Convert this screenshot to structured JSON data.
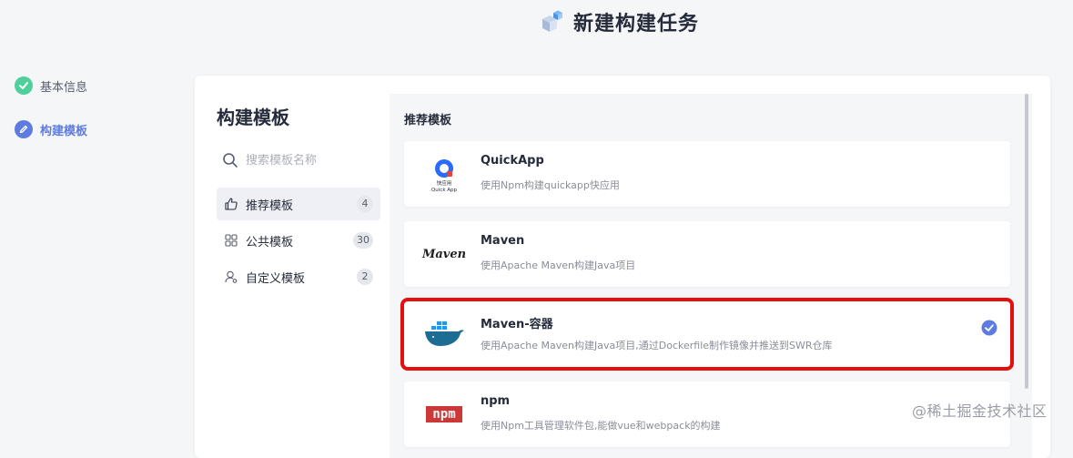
{
  "page": {
    "title": "新建构建任务"
  },
  "steps": [
    {
      "label": "基本信息",
      "state": "done"
    },
    {
      "label": "构建模板",
      "state": "active"
    }
  ],
  "sidebar": {
    "title": "构建模板",
    "search_placeholder": "搜索模板名称",
    "items": [
      {
        "label": "推荐模板",
        "count": "4",
        "active": true,
        "icon": "thumbs-up-icon"
      },
      {
        "label": "公共模板",
        "count": "30",
        "active": false,
        "icon": "grid-icon"
      },
      {
        "label": "自定义模板",
        "count": "2",
        "active": false,
        "icon": "user-icon"
      }
    ]
  },
  "main": {
    "section_label": "推荐模板",
    "templates": [
      {
        "name": "QuickApp",
        "desc": "使用Npm构建quickapp快应用",
        "logo": "quickapp-logo",
        "logo_text_1": "快应用",
        "logo_text_2": "Quick App"
      },
      {
        "name": "Maven",
        "desc": "使用Apache Maven构建Java项目",
        "logo": "maven-logo",
        "logo_text": "Maven"
      },
      {
        "name": "Maven-容器",
        "desc": "使用Apache Maven构建Java项目,通过Dockerfile制作镜像并推送到SWR仓库",
        "logo": "docker-logo",
        "selected": true
      },
      {
        "name": "npm",
        "desc": "使用Npm工具管理软件包,能做vue和webpack的构建",
        "logo": "npm-logo",
        "logo_text": "npm"
      }
    ]
  },
  "watermark": "@稀土掘金技术社区",
  "colors": {
    "accent": "#5e7ce0",
    "success": "#4ecf9b",
    "highlight": "#e50f0f"
  }
}
